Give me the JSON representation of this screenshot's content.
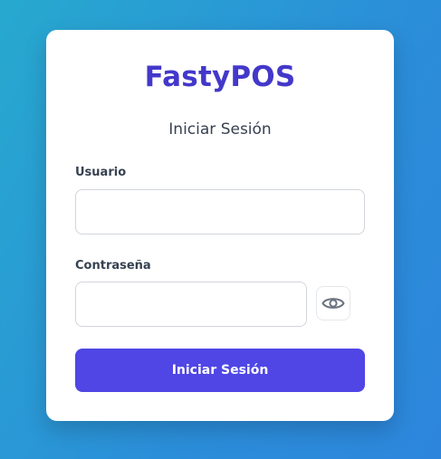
{
  "login": {
    "brand": "FastyPOS",
    "title": "Iniciar Sesión",
    "username_label": "Usuario",
    "username_value": "",
    "password_label": "Contraseña",
    "password_value": "",
    "toggle_icon": "eye-icon",
    "submit_label": "Iniciar Sesión"
  },
  "colors": {
    "brand": "#4338ca",
    "button": "#4f46e5",
    "background_start": "#27a9cf",
    "background_end": "#2d86dc"
  }
}
